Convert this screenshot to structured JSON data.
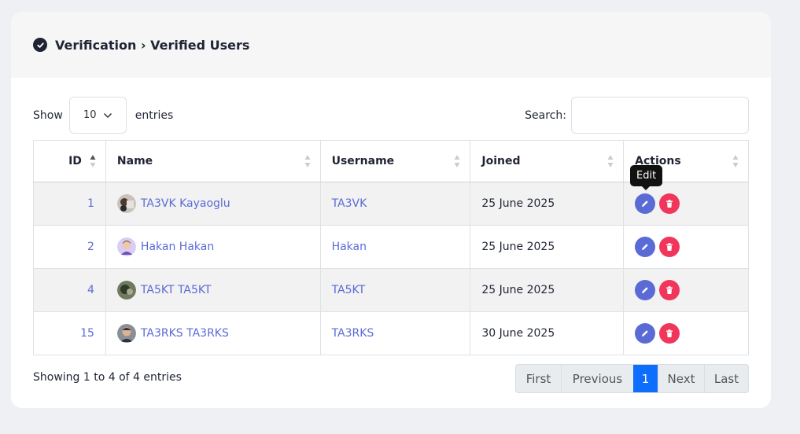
{
  "header": {
    "title": "Verification › Verified Users"
  },
  "controls": {
    "show_label": "Show",
    "page_length": "10",
    "entries_label": "entries",
    "search_label": "Search:",
    "search_value": ""
  },
  "table": {
    "columns": [
      "ID",
      "Name",
      "Username",
      "Joined",
      "Actions"
    ],
    "rows": [
      {
        "id": "1",
        "name": "TA3VK Kayaoglu",
        "username": "TA3VK",
        "joined": "25 June 2025"
      },
      {
        "id": "2",
        "name": "Hakan Hakan",
        "username": "Hakan",
        "joined": "25 June 2025"
      },
      {
        "id": "4",
        "name": "TA5KT TA5KT",
        "username": "TA5KT",
        "joined": "25 June 2025"
      },
      {
        "id": "15",
        "name": "TA3RKS TA3RKS",
        "username": "TA3RKS",
        "joined": "30 June 2025"
      }
    ]
  },
  "tooltip": {
    "text": "Edit"
  },
  "footer": {
    "info": "Showing 1 to 4 of 4 entries"
  },
  "pagination": {
    "first": "First",
    "previous": "Previous",
    "current": "1",
    "next": "Next",
    "last": "Last"
  },
  "colors": {
    "accent": "#5b6bd6",
    "danger": "#f0365a",
    "active_page": "#0d6efd"
  }
}
